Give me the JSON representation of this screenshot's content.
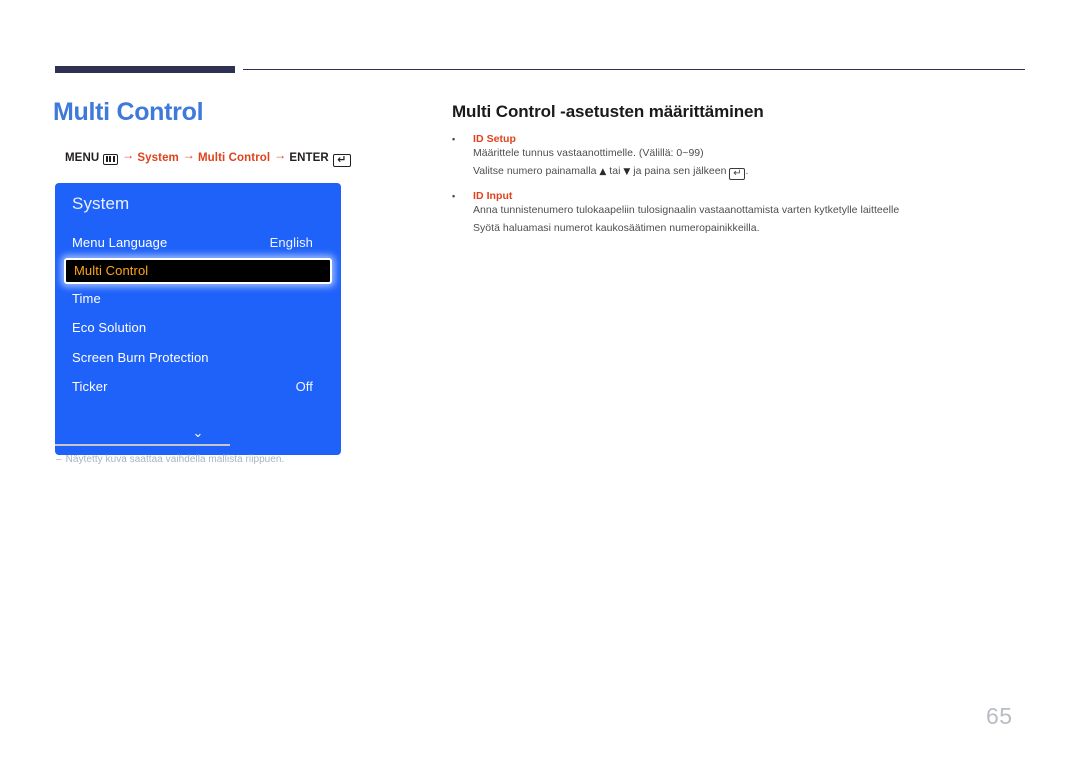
{
  "page": {
    "title": "Multi Control",
    "number": "65"
  },
  "breadcrumb": {
    "menu_label": "MENU",
    "menu_icon": "menu-grid-icon",
    "arrow": "→",
    "step1": "System",
    "step2": "Multi Control",
    "enter_label": "ENTER",
    "enter_icon": "enter-key-icon",
    "enter_glyph": "↵"
  },
  "osd": {
    "heading": "System",
    "chevron": "⌄",
    "items": [
      {
        "label": "Menu Language",
        "value": "English",
        "selected": false
      },
      {
        "label": "Multi Control",
        "value": "",
        "selected": true
      },
      {
        "label": "Time",
        "value": "",
        "selected": false
      },
      {
        "label": "Eco Solution",
        "value": "",
        "selected": false
      },
      {
        "label": "Screen Burn Protection",
        "value": "",
        "selected": false
      },
      {
        "label": "Ticker",
        "value": "Off",
        "selected": false
      }
    ]
  },
  "footnote": {
    "dash": "–",
    "text": "Näytetty kuva saattaa vaihdella mallista riippuen."
  },
  "content": {
    "section_title": "Multi Control -asetusten määrittäminen",
    "bullet_marker": "•",
    "items": [
      {
        "label": "ID Setup",
        "lines": [
          {
            "pre": "Määrittele tunnus vastaanottimelle. (Välillä: 0~99)",
            "post": "",
            "mid": "",
            "has_keys": false
          },
          {
            "pre": "Valitse numero painamalla ",
            "mid": " tai ",
            "post": " ja paina sen jälkeen ",
            "has_keys": true,
            "up": "▲",
            "down": "▼",
            "enter_glyph": "↵",
            "tail": "."
          }
        ]
      },
      {
        "label": "ID Input",
        "lines": [
          {
            "pre": "Anna tunnistenumero tulokaapeliin tulosignaalin vastaanottamista varten kytketylle laitteelle",
            "post": "",
            "mid": "",
            "has_keys": false
          },
          {
            "pre": "Syötä haluamasi numerot kaukosäätimen numeropainikkeilla.",
            "post": "",
            "mid": "",
            "has_keys": false
          }
        ]
      }
    ]
  },
  "colors": {
    "osd_blue": "#1F62FA",
    "title_blue": "#3F7ADA",
    "accent_red": "#E0421C",
    "rule_navy": "#2E3152",
    "selected_text": "#FFA516"
  }
}
